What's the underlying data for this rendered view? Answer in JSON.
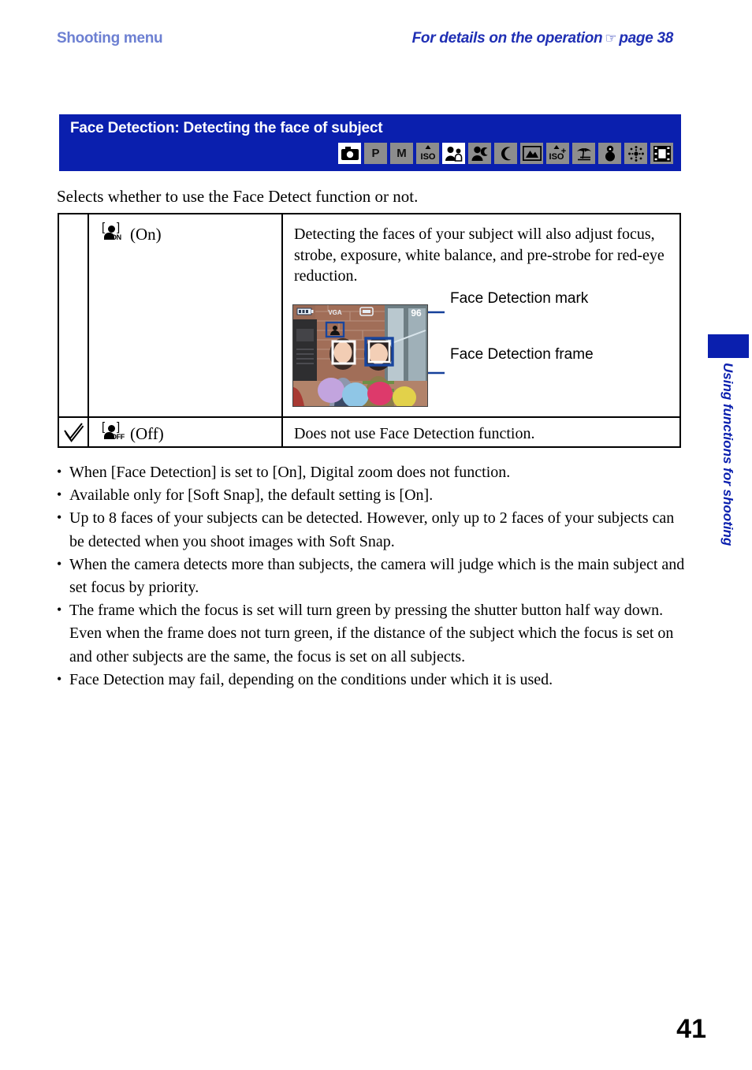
{
  "header": {
    "left_title": "Shooting menu",
    "right_prefix": "For details on the operation",
    "hand_icon": "☞",
    "right_suffix": "page 38"
  },
  "banner": {
    "title": "Face Detection: Detecting the face of subject",
    "modes": [
      {
        "name": "still-camera-mode-icon",
        "label": "",
        "highlighted": true
      },
      {
        "name": "program-auto-mode-icon",
        "label": "P",
        "highlighted": false
      },
      {
        "name": "manual-mode-icon",
        "label": "M",
        "highlighted": false
      },
      {
        "name": "high-sensitivity-mode-icon",
        "label": "ISO",
        "highlighted": false
      },
      {
        "name": "soft-snap-mode-icon",
        "label": "",
        "highlighted": true
      },
      {
        "name": "twilight-portrait-mode-icon",
        "label": "",
        "highlighted": false
      },
      {
        "name": "twilight-mode-icon",
        "label": "",
        "highlighted": false
      },
      {
        "name": "landscape-mode-icon",
        "label": "",
        "highlighted": false
      },
      {
        "name": "high-sensitivity-plus-mode-icon",
        "label": "ISO+",
        "highlighted": false
      },
      {
        "name": "beach-mode-icon",
        "label": "",
        "highlighted": false
      },
      {
        "name": "snow-mode-icon",
        "label": "",
        "highlighted": false
      },
      {
        "name": "fireworks-mode-icon",
        "label": "",
        "highlighted": false
      },
      {
        "name": "movie-mode-icon",
        "label": "",
        "highlighted": false
      }
    ]
  },
  "intro": "Selects whether to use the Face Detect function or not.",
  "table": {
    "rows": [
      {
        "checked": false,
        "icon_sub": "ON",
        "label": "(On)",
        "description": "Detecting the faces of your subject will also adjust focus, strobe, exposure, white balance, and pre-strobe for red-eye reduction.",
        "has_illustration": true
      },
      {
        "checked": true,
        "icon_sub": "OFF",
        "label": "(Off)",
        "description": "Does not use Face Detection function.",
        "has_illustration": false
      }
    ]
  },
  "illustration": {
    "callout_mark": "Face Detection mark",
    "callout_frame": "Face Detection frame",
    "lcd": {
      "battery": "battery-icon",
      "image_size": "VGA",
      "flash": "flash-mode-icon",
      "shots_remaining": "96",
      "face_mark": "face-detection-mark-icon"
    }
  },
  "notes": [
    "When [Face Detection] is set to [On], Digital zoom does not function.",
    "Available only for [Soft Snap], the default setting is [On].",
    "Up to 8 faces of your subjects can be detected. However, only up to 2 faces of your subjects can be detected when you shoot images with Soft Snap.",
    "When the camera detects more than subjects, the camera will judge which is the main subject and set focus by priority.",
    "The frame which the focus is set will turn green by pressing the shutter button half way down. Even when the frame does not turn green, if the distance of the subject which the focus is set on and other subjects are the same, the focus is set on all subjects.",
    "Face Detection may fail, depending on the conditions under which it is used."
  ],
  "side_tab": {
    "label": "Using functions for shooting"
  },
  "page_number": "41",
  "colors": {
    "brand_blue": "#0a1fae",
    "header_left_blue": "#6d80d2",
    "header_right_blue": "#1f2fb4",
    "mode_icon_gray": "#8d8d8d"
  }
}
